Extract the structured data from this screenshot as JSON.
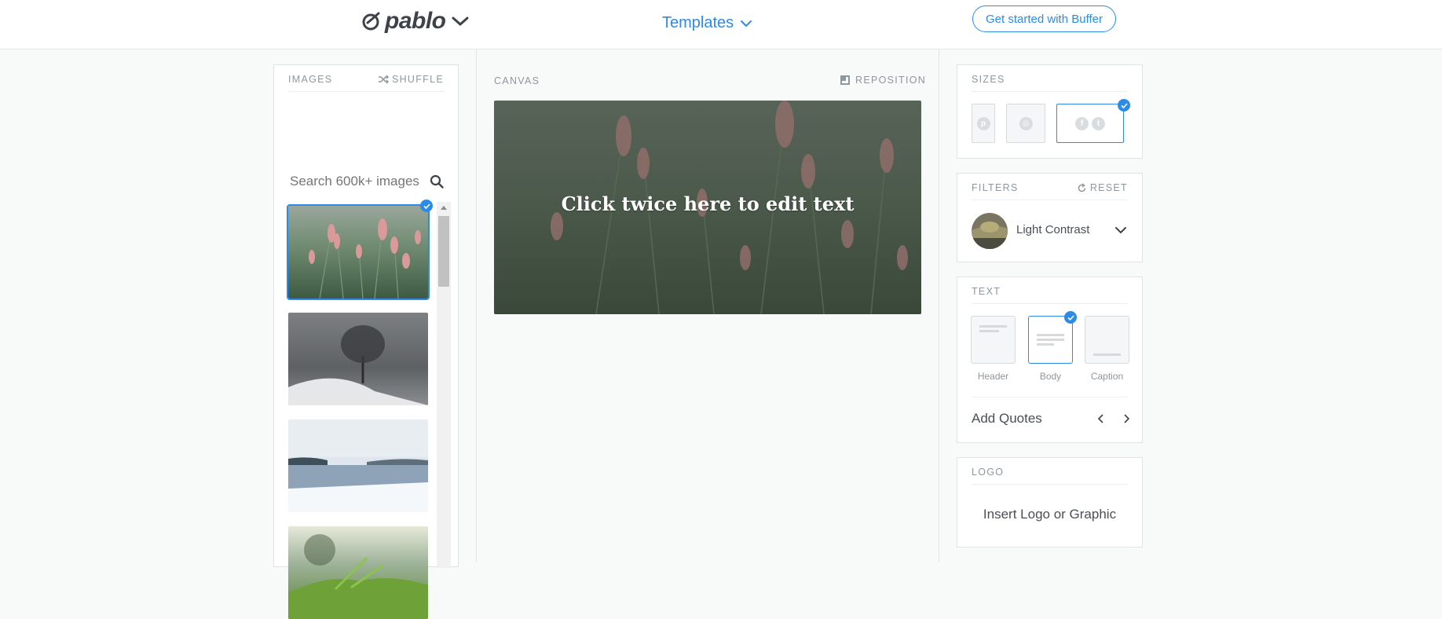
{
  "header": {
    "logo_text": "pablo",
    "templates_label": "Templates",
    "cta_label": "Get started with Buffer"
  },
  "images": {
    "title": "IMAGES",
    "shuffle_label": "SHUFFLE",
    "search_placeholder": "Search 600k+ images",
    "thumbnails": [
      {
        "subject": "pink grass field",
        "selected": true
      },
      {
        "subject": "snowy tree",
        "selected": false
      },
      {
        "subject": "winter lake",
        "selected": false
      },
      {
        "subject": "green fern close-up",
        "selected": false
      }
    ]
  },
  "canvas": {
    "title": "CANVAS",
    "reposition_label": "REPOSITION",
    "text": "Click twice here to edit text"
  },
  "sizes": {
    "title": "SIZES",
    "options": [
      {
        "name": "Pinterest",
        "selected": false
      },
      {
        "name": "Instagram",
        "selected": false
      },
      {
        "name": "Facebook / Twitter",
        "selected": true
      }
    ]
  },
  "filters": {
    "title": "FILTERS",
    "reset_label": "RESET",
    "selected": "Light Contrast"
  },
  "text_panel": {
    "title": "TEXT",
    "styles": [
      {
        "label": "Header",
        "selected": false
      },
      {
        "label": "Body",
        "selected": true
      },
      {
        "label": "Caption",
        "selected": false
      }
    ],
    "add_quotes_label": "Add Quotes"
  },
  "logo_panel": {
    "title": "LOGO",
    "insert_label": "Insert Logo or Graphic"
  },
  "colors": {
    "accent": "#2c8be8",
    "panel_border": "#dfe3e6",
    "muted_text": "#8f969c"
  }
}
